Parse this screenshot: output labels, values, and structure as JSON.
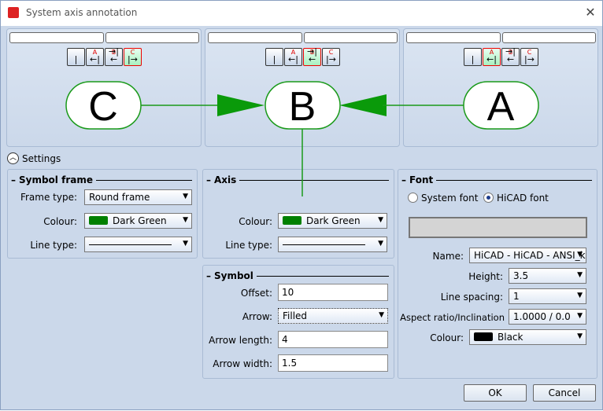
{
  "title": "System axis annotation",
  "labels": {
    "C": "C",
    "B": "B",
    "A": "A"
  },
  "icon_buttons": [
    "|",
    "A",
    "B",
    "C"
  ],
  "settings_label": "Settings",
  "symbol_frame": {
    "title": "Symbol frame",
    "frame_type_label": "Frame type:",
    "frame_type": "Round frame",
    "colour_label": "Colour:",
    "colour": "Dark Green",
    "colour_hex": "#008000",
    "line_type_label": "Line type:"
  },
  "axis": {
    "title": "Axis",
    "colour_label": "Colour:",
    "colour": "Dark Green",
    "colour_hex": "#008000",
    "line_type_label": "Line type:"
  },
  "symbol": {
    "title": "Symbol",
    "offset_label": "Offset:",
    "offset": "10",
    "arrow_label": "Arrow:",
    "arrow": "Filled",
    "arrow_length_label": "Arrow length:",
    "arrow_length": "4",
    "arrow_width_label": "Arrow width:",
    "arrow_width": "1.5"
  },
  "font": {
    "title": "Font",
    "system_font": "System font",
    "hicad_font": "HiCAD font",
    "name_label": "Name:",
    "name": "HiCAD - HiCAD - ANSI_k",
    "height_label": "Height:",
    "height": "3.5",
    "line_spacing_label": "Line spacing:",
    "line_spacing": "1",
    "aspect_label": "Aspect ratio/Inclination",
    "aspect": "1.0000 / 0.0",
    "colour_label": "Colour:",
    "colour": "Black",
    "colour_hex": "#000000"
  },
  "buttons": {
    "ok": "OK",
    "cancel": "Cancel"
  }
}
